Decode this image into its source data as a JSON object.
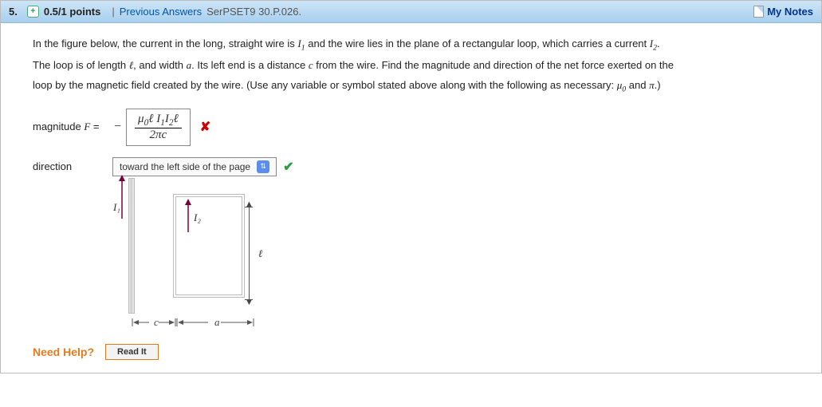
{
  "header": {
    "question_number": "5.",
    "points": "0.5/1 points",
    "prev_answers": "Previous Answers",
    "assignment": "SerPSET9 30.P.026.",
    "my_notes": "My Notes"
  },
  "problem": {
    "line1_a": "In the figure below, the current in the long, straight wire is ",
    "I1": "I",
    "I1_sub": "1",
    "line1_b": " and the wire lies in the plane of a rectangular loop, which carries a current ",
    "I2": "I",
    "I2_sub": "2",
    "line1_c": ".",
    "line2_a": "The loop is of length ",
    "ell": "ℓ",
    "line2_b": ", and width ",
    "a": "a",
    "line2_c": ". Its left end is a distance ",
    "c": "c",
    "line2_d": " from the wire. Find the magnitude and direction of the net force exerted on the",
    "line3_a": "loop by the magnetic field created by the wire. (Use any variable or symbol stated above along with the following as necessary: ",
    "mu0": "μ",
    "mu0_sub": "0",
    "line3_b": " and ",
    "pi": "π",
    "line3_c": ".)"
  },
  "answers": {
    "magnitude_label": "magnitude F =",
    "magnitude_numer": "μ₀ℓ I₁I₂ℓ",
    "magnitude_denom": "2πc",
    "direction_label": "direction",
    "direction_value": "toward the left side of the page"
  },
  "figure": {
    "I1": "I₁",
    "I2": "I₂",
    "ell": "ℓ",
    "c": "c",
    "a": "a"
  },
  "help": {
    "label": "Need Help?",
    "read": "Read It"
  }
}
